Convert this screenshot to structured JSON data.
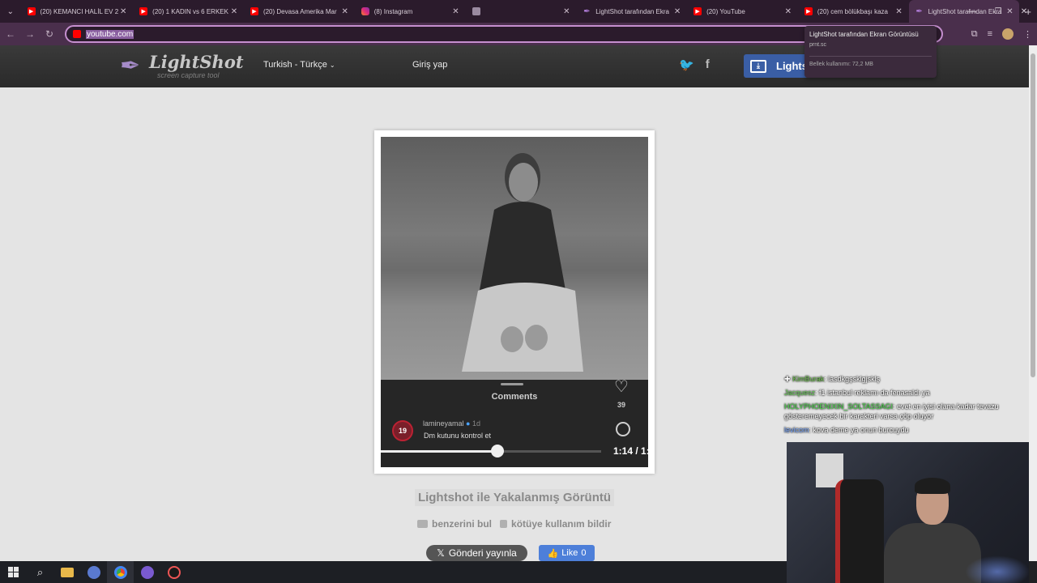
{
  "browser": {
    "tabs": [
      {
        "label": "(20) KEMANCI HALİL EV 2",
        "favicon": "youtube-icon"
      },
      {
        "label": "(20) 1 KADIN vs 6 ERKEK",
        "favicon": "youtube-icon"
      },
      {
        "label": "(20) Devasa Amerika Mar",
        "favicon": "youtube-icon"
      },
      {
        "label": "(8) Instagram",
        "favicon": "instagram-icon"
      },
      {
        "label": "",
        "favicon": "page-icon"
      },
      {
        "label": "LightShot tarafından Ekra",
        "favicon": "lightshot-icon"
      },
      {
        "label": "(20) YouTube",
        "favicon": "youtube-icon"
      },
      {
        "label": "(20) cem bölükbaşı kaza",
        "favicon": "youtube-icon"
      },
      {
        "label": "LightShot tarafından Ekra",
        "favicon": "lightshot-icon",
        "active": true
      }
    ],
    "new_tab": "+",
    "address": "youtube.com",
    "tooltip": {
      "title": "LightShot tarafından Ekran Görüntüsü",
      "url": "prnt.sc",
      "memory": "Bellek kullanımı: 72,2 MB"
    }
  },
  "site": {
    "logo_title": "LightShot",
    "logo_subtitle": "screen capture tool",
    "language": "Turkish - Türkçe",
    "login": "Giriş yap",
    "install_label": "Lights",
    "social": {
      "twitter": "twitter-icon",
      "facebook": "f"
    }
  },
  "screenshot": {
    "comments_title": "Comments",
    "like_count": "39",
    "comment": {
      "avatar_text": "19",
      "user": "lamineyamal",
      "time": "1d",
      "text": "Dm kutunu kontrol et"
    },
    "time_display": "1:14 / 1:",
    "progress_fraction": 0.53
  },
  "page": {
    "caption": "Lightshot ile Yakalanmış Görüntü",
    "find_similar": "benzerini bul",
    "report_abuse": "kötüye kullanım bildir",
    "tweet_button": "Gönderi yayınla",
    "like_button": "Like",
    "like_count": "0"
  },
  "stream_chat": [
    {
      "user": "KimBurak",
      "message": ": lasdkgşsklgjsklş",
      "color": "#6bc04b"
    },
    {
      "user": "Jacquesz",
      "message": ": f1 istanbul reklamı da fenasaldı ya",
      "color": "#6bd05b"
    },
    {
      "user": "HOLYPHOENIXIN_SOLTASSAGI",
      "message": ": evet en iyisi olana kadar tevazu gösteremeyecek bir karakteri varsa çöp oluyor",
      "color": "#4bd84b"
    },
    {
      "user": "levicom",
      "message": ": kova deme ya onun burcuydu",
      "color": "#7aa8ff"
    }
  ],
  "taskbar": [
    "windows-icon",
    "search-icon",
    "file-explorer-icon",
    "app-icon",
    "chrome-icon",
    "discord-icon",
    "obs-icon"
  ]
}
